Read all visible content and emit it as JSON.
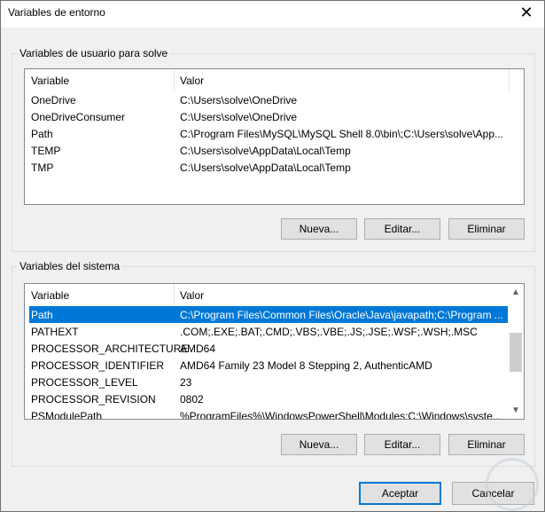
{
  "window": {
    "title": "Variables de entorno",
    "close": "✕"
  },
  "user_group": {
    "legend": "Variables de usuario para solve",
    "headers": [
      "Variable",
      "Valor"
    ],
    "rows": [
      {
        "name": "OneDrive",
        "value": "C:\\Users\\solve\\OneDrive"
      },
      {
        "name": "OneDriveConsumer",
        "value": "C:\\Users\\solve\\OneDrive"
      },
      {
        "name": "Path",
        "value": "C:\\Program Files\\MySQL\\MySQL Shell 8.0\\bin\\;C:\\Users\\solve\\App..."
      },
      {
        "name": "TEMP",
        "value": "C:\\Users\\solve\\AppData\\Local\\Temp"
      },
      {
        "name": "TMP",
        "value": "C:\\Users\\solve\\AppData\\Local\\Temp"
      }
    ],
    "buttons": {
      "new": "Nueva...",
      "edit": "Editar...",
      "delete": "Eliminar"
    }
  },
  "system_group": {
    "legend": "Variables del sistema",
    "headers": [
      "Variable",
      "Valor"
    ],
    "rows": [
      {
        "name": "Path",
        "value": "C:\\Program Files\\Common Files\\Oracle\\Java\\javapath;C:\\Program ...",
        "selected": true
      },
      {
        "name": "PATHEXT",
        "value": ".COM;.EXE;.BAT;.CMD;.VBS;.VBE;.JS;.JSE;.WSF;.WSH;.MSC"
      },
      {
        "name": "PROCESSOR_ARCHITECTURE",
        "value": "AMD64"
      },
      {
        "name": "PROCESSOR_IDENTIFIER",
        "value": "AMD64 Family 23 Model 8 Stepping 2, AuthenticAMD"
      },
      {
        "name": "PROCESSOR_LEVEL",
        "value": "23"
      },
      {
        "name": "PROCESSOR_REVISION",
        "value": "0802"
      },
      {
        "name": "PSModulePath",
        "value": "%ProgramFiles%\\WindowsPowerShell\\Modules;C:\\Windows\\syste..."
      }
    ],
    "buttons": {
      "new": "Nueva...",
      "edit": "Editar...",
      "delete": "Eliminar"
    }
  },
  "footer": {
    "ok": "Aceptar",
    "cancel": "Cancelar"
  },
  "colors": {
    "selection": "#0078d7"
  }
}
